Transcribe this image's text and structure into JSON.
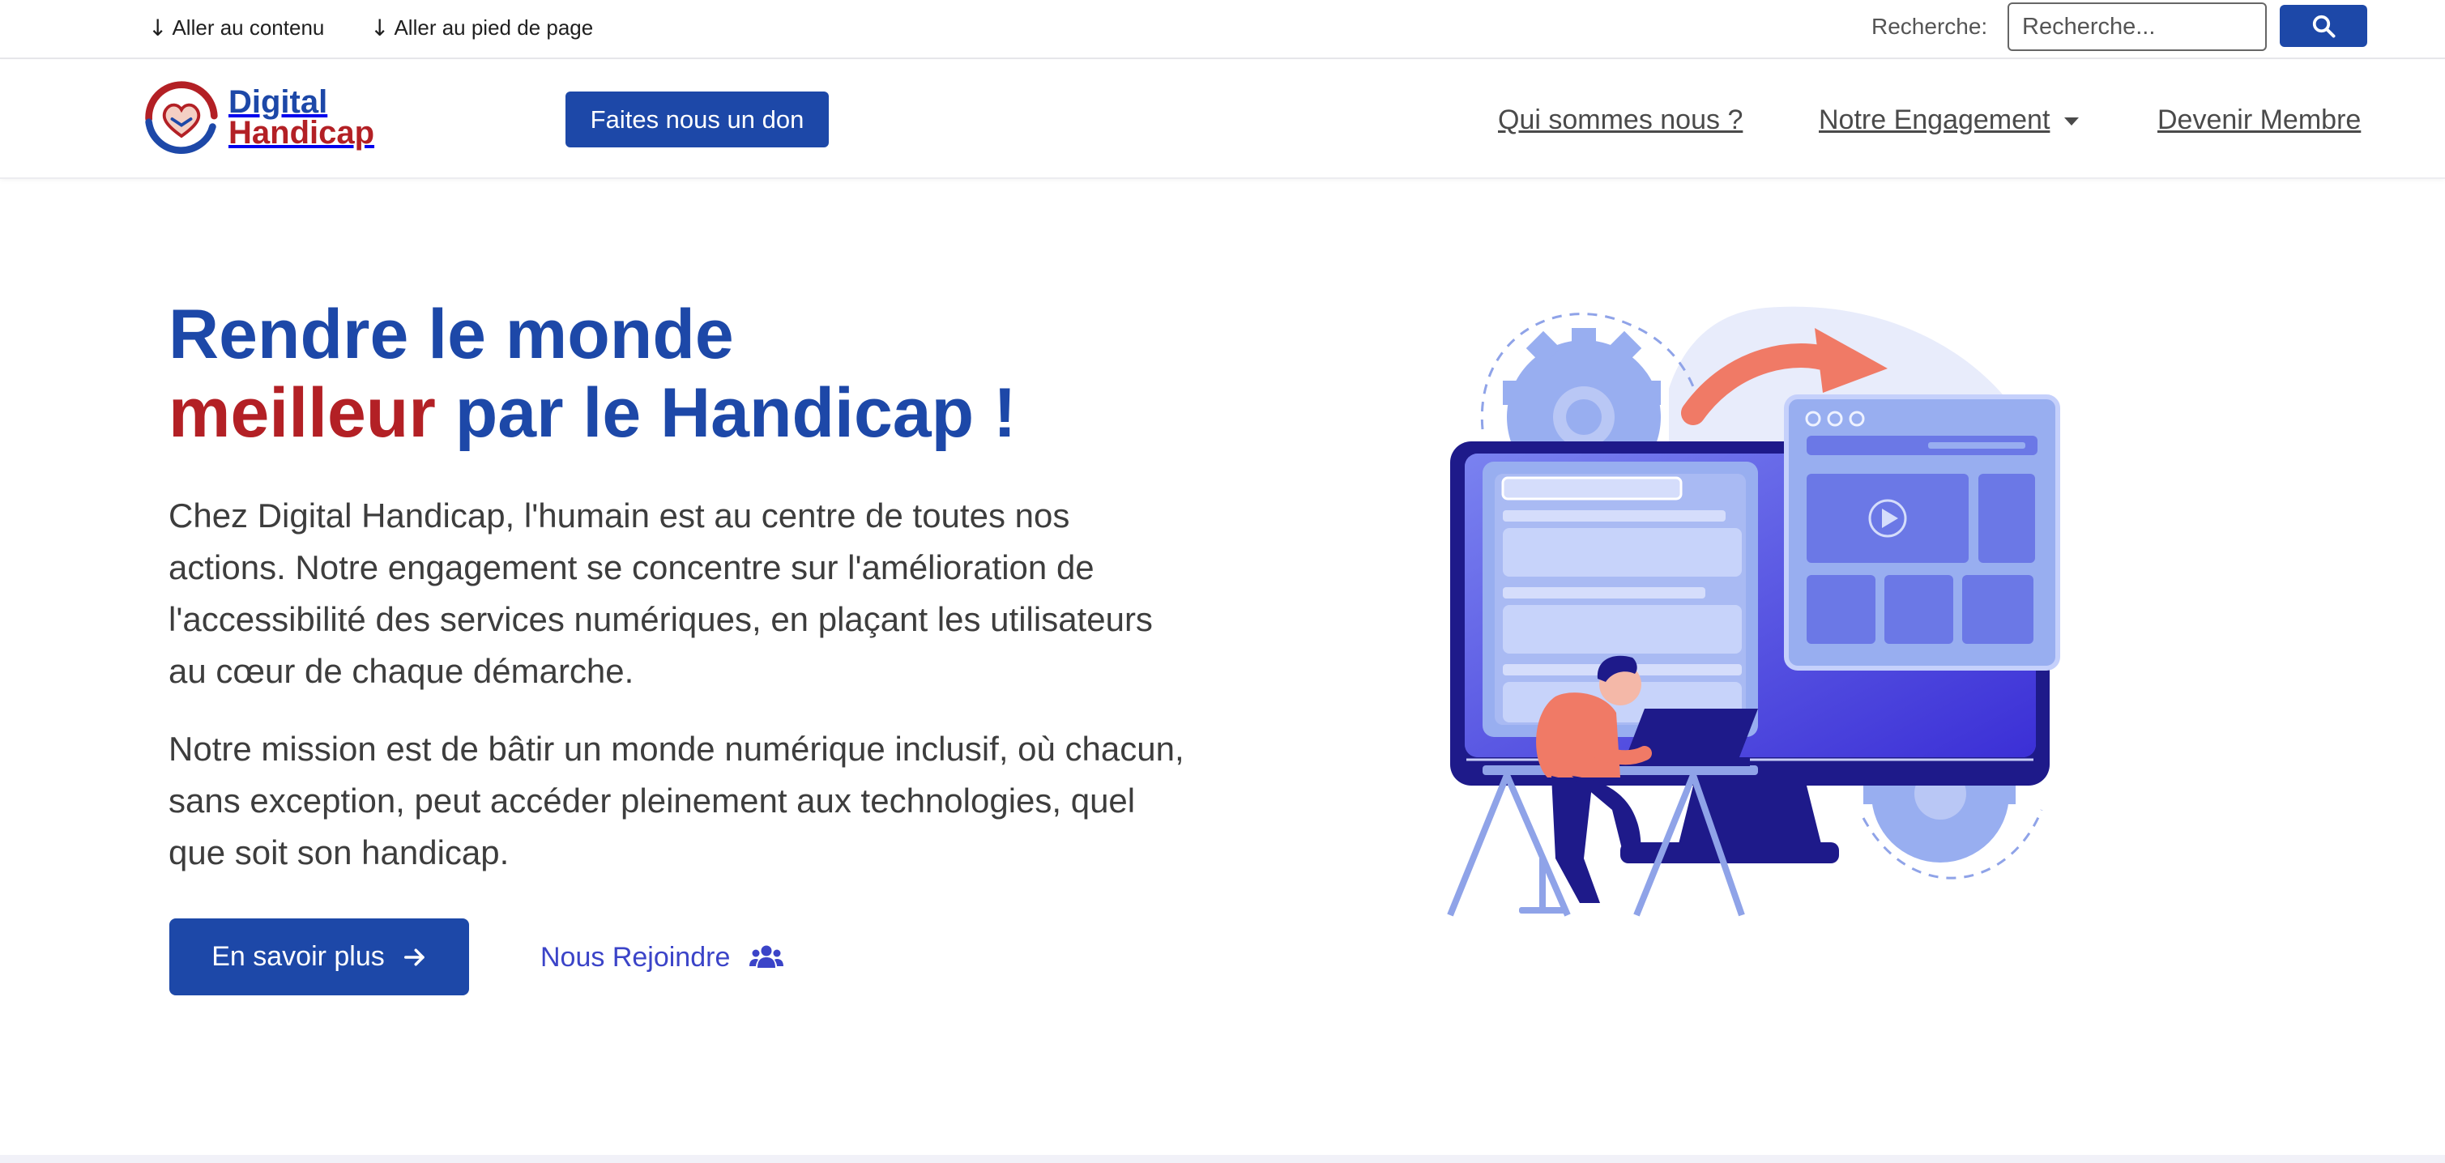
{
  "topbar": {
    "skip_content": "Aller au contenu",
    "skip_footer": "Aller au pied de page",
    "search_label": "Recherche:",
    "search_placeholder": "Recherche...",
    "search_button_icon": "search-icon"
  },
  "navbar": {
    "logo_line1": "Digital",
    "logo_line2": "Handicap",
    "donate_label": "Faites nous un don",
    "links": [
      {
        "label": "Qui sommes nous ?"
      },
      {
        "label": "Notre Engagement",
        "has_dropdown": true
      },
      {
        "label": "Devenir Membre"
      }
    ]
  },
  "hero": {
    "title_line1": "Rendre le monde",
    "title_accent": "meilleur",
    "title_rest": " par le Handicap !",
    "paragraph1": "Chez Digital Handicap, l'humain est au centre de toutes nos actions. Notre engagement se concentre sur l'amélioration de l'accessibilité des services numériques, en plaçant les utilisateurs au cœur de chaque démarche.",
    "paragraph2": "Notre mission est de bâtir un monde numérique inclusif, où chacun, sans exception, peut accéder pleinement aux technologies, quel que soit son handicap.",
    "primary_cta": "En savoir plus",
    "secondary_cta": "Nous Rejoindre"
  },
  "colors": {
    "brand_blue": "#1d48a8",
    "brand_red": "#b32025",
    "link_violet": "#3b44c8"
  }
}
